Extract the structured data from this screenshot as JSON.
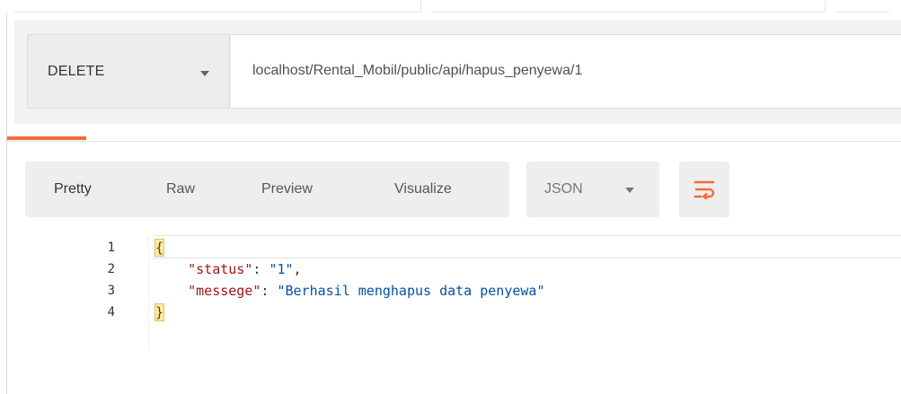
{
  "request": {
    "method": "DELETE",
    "url": "localhost/Rental_Mobil/public/api/hapus_penyewa/1"
  },
  "response_toolbar": {
    "formats": [
      "Pretty",
      "Raw",
      "Preview",
      "Visualize"
    ],
    "selected_format": "Pretty",
    "language": "JSON",
    "wrap_icon": "wrap-lines-icon"
  },
  "code": {
    "lines": [
      {
        "num": "1",
        "text": "{"
      },
      {
        "num": "2",
        "key": "\"status\"",
        "sep": ": ",
        "value": "\"1\"",
        "trail": ","
      },
      {
        "num": "3",
        "key": "\"messege\"",
        "sep": ": ",
        "value": "\"Berhasil menghapus data penyewa\"",
        "trail": ""
      },
      {
        "num": "4",
        "text": "}"
      }
    ]
  },
  "colors": {
    "accent": "#f26b3a",
    "json_key": "#a31515",
    "json_string": "#0451a5"
  }
}
